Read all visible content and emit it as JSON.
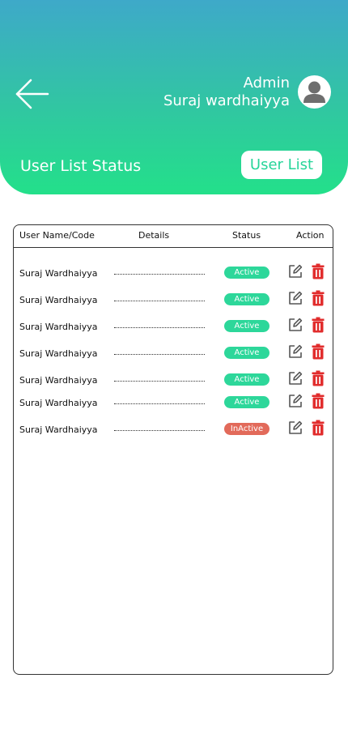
{
  "header": {
    "admin_role": "Admin",
    "admin_name": "Suraj wardhaiyya",
    "page_title": "User List Status",
    "user_list_button": "User List"
  },
  "icons": {
    "back": "arrow-left-icon",
    "avatar": "user-avatar-icon",
    "edit": "edit-pencil-icon",
    "delete": "trash-icon"
  },
  "colors": {
    "active": "#2dd79a",
    "inactive": "#e26a5a",
    "delete": "#e12c2c",
    "edit": "#555555"
  },
  "table": {
    "headers": [
      "User Name/Code",
      "Details",
      "Status",
      "Action"
    ],
    "rows": [
      {
        "name": "Suraj Wardhaiyya",
        "status": "Active"
      },
      {
        "name": "Suraj Wardhaiyya",
        "status": "Active"
      },
      {
        "name": "Suraj Wardhaiyya",
        "status": "Active"
      },
      {
        "name": "Suraj Wardhaiyya",
        "status": "Active"
      },
      {
        "name": "Suraj Wardhaiyya",
        "status": "Active"
      },
      {
        "name": "Suraj Wardhaiyya",
        "status": "Active"
      },
      {
        "name": "Suraj Wardhaiyya",
        "status": "InActive"
      }
    ]
  }
}
